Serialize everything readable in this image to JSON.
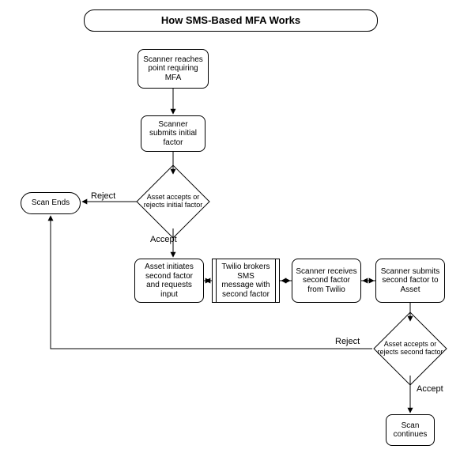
{
  "title": "How SMS-Based MFA Works",
  "nodes": {
    "n1": "Scanner reaches point requiring MFA",
    "n2": "Scanner submits initial factor",
    "d1": "Asset accepts or rejects initial factor",
    "n3": "Asset initiates second factor and requests input",
    "n4": "Twilio brokers SMS message with second factor",
    "n5": "Scanner receives second factor from Twilio",
    "n6": "Scanner submits second factor to Asset",
    "d2": "Asset accepts or rejects second factor",
    "n7": "Scan continues",
    "end": "Scan  Ends"
  },
  "edge_labels": {
    "reject1": "Reject",
    "accept1": "Accept",
    "reject2": "Reject",
    "accept2": "Accept"
  },
  "chart_data": {
    "type": "flowchart",
    "title": "How SMS-Based MFA Works",
    "nodes": [
      {
        "id": "n1",
        "kind": "process",
        "label": "Scanner reaches point requiring MFA"
      },
      {
        "id": "n2",
        "kind": "process",
        "label": "Scanner submits initial factor"
      },
      {
        "id": "d1",
        "kind": "decision",
        "label": "Asset accepts or rejects initial factor"
      },
      {
        "id": "n3",
        "kind": "process",
        "label": "Asset initiates second factor and requests input"
      },
      {
        "id": "n4",
        "kind": "subprocess",
        "label": "Twilio brokers SMS message with second factor"
      },
      {
        "id": "n5",
        "kind": "process",
        "label": "Scanner receives second factor from Twilio"
      },
      {
        "id": "n6",
        "kind": "process",
        "label": "Scanner submits second factor to Asset"
      },
      {
        "id": "d2",
        "kind": "decision",
        "label": "Asset accepts or rejects second factor"
      },
      {
        "id": "n7",
        "kind": "process",
        "label": "Scan continues"
      },
      {
        "id": "end",
        "kind": "terminator",
        "label": "Scan Ends"
      }
    ],
    "edges": [
      {
        "from": "n1",
        "to": "n2"
      },
      {
        "from": "n2",
        "to": "d1"
      },
      {
        "from": "d1",
        "to": "end",
        "label": "Reject"
      },
      {
        "from": "d1",
        "to": "n3",
        "label": "Accept"
      },
      {
        "from": "n3",
        "to": "n4"
      },
      {
        "from": "n4",
        "to": "n5"
      },
      {
        "from": "n5",
        "to": "n6"
      },
      {
        "from": "n6",
        "to": "d2"
      },
      {
        "from": "d2",
        "to": "end",
        "label": "Reject"
      },
      {
        "from": "d2",
        "to": "n7",
        "label": "Accept"
      }
    ]
  }
}
